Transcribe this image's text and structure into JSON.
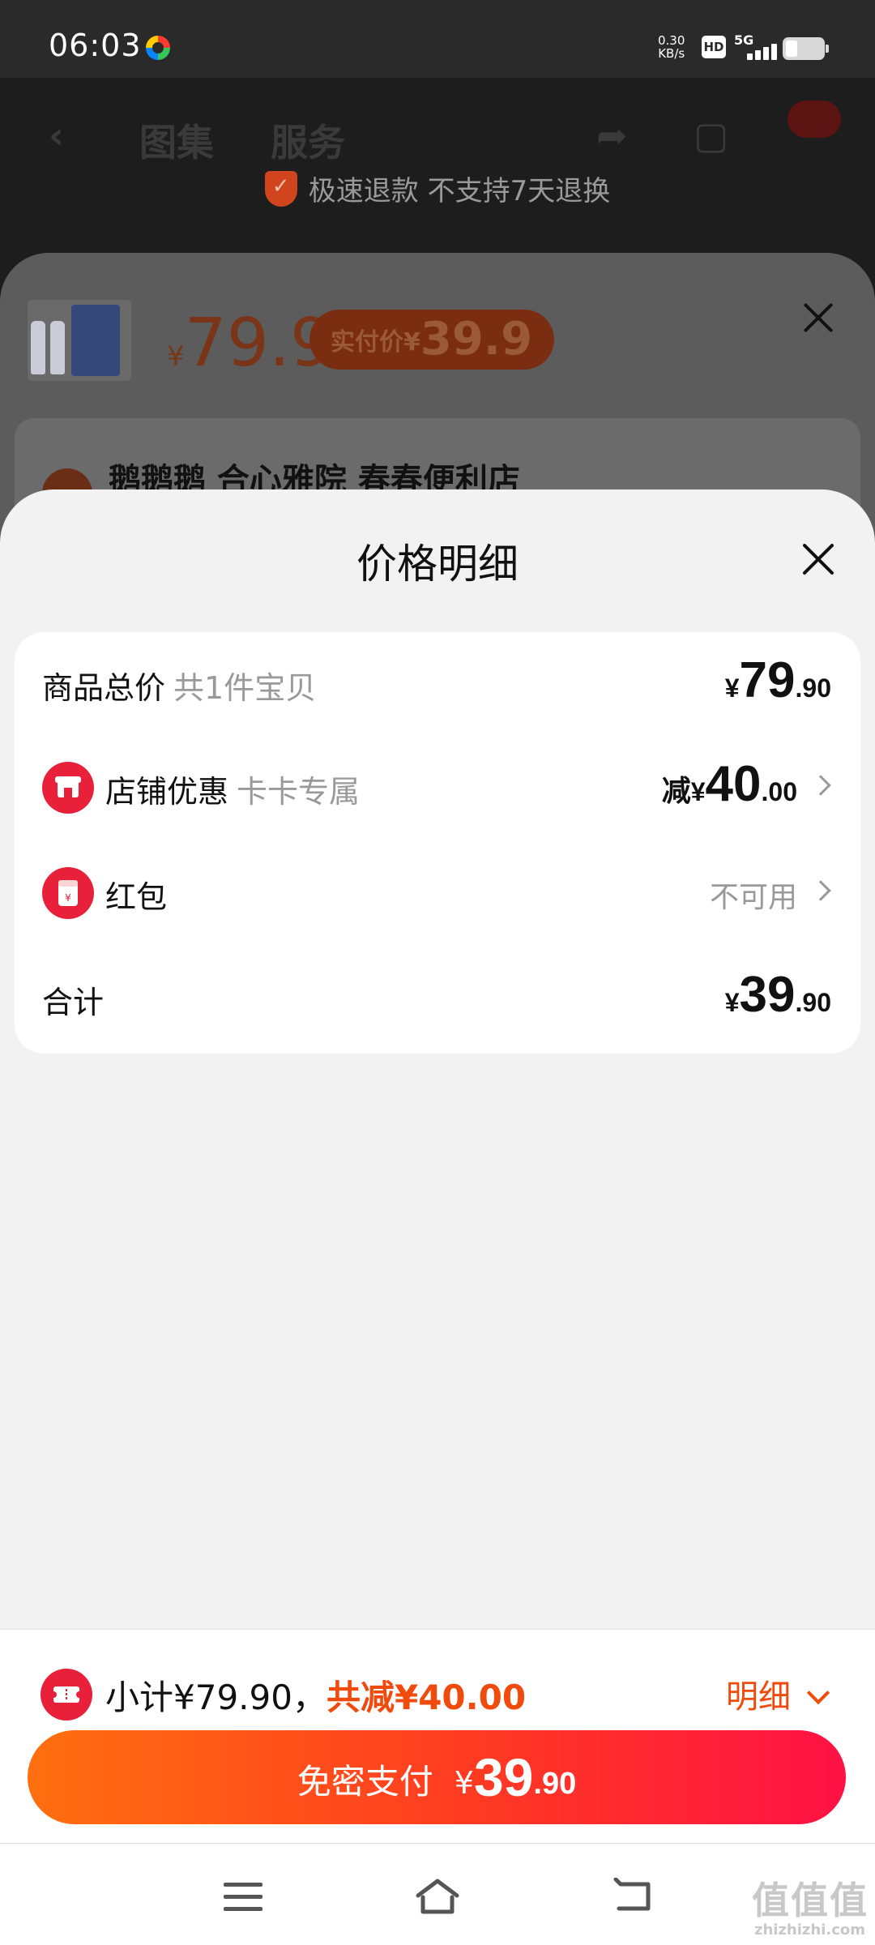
{
  "status_bar": {
    "time": "06:03",
    "net_speed": "0.30",
    "net_unit": "KB/s",
    "hd": "HD",
    "network": "5G"
  },
  "background_page": {
    "nav_tabs": [
      "图集",
      "服务"
    ],
    "guarantee": "极速退款 不支持7天退换",
    "product_price_currency": "¥",
    "product_price": "79.9",
    "actual_price_label": "实付价",
    "actual_price_currency": "¥",
    "actual_price": "39.9",
    "store_line": "鹅鹅鹅 合心雅院 春春便利店"
  },
  "price_detail": {
    "title": "价格明细",
    "rows": [
      {
        "label": "商品总价",
        "sub": "共1件宝贝",
        "currency": "¥",
        "int": "79",
        "dec": ".90"
      },
      {
        "label": "店铺优惠",
        "sub": "卡卡专属",
        "prefix": "减",
        "currency": "¥",
        "int": "40",
        "dec": ".00",
        "icon": "store-icon",
        "color": "#f04a0c"
      },
      {
        "label": "红包",
        "value": "不可用",
        "icon": "red-packet-icon"
      },
      {
        "label": "合计",
        "currency": "¥",
        "int": "39",
        "dec": ".90"
      }
    ]
  },
  "bottom_bar": {
    "subtotal_label": "小计¥79.90，",
    "saving_label": "共减¥40.00",
    "detail_label": "明细",
    "pay_label": "免密支付",
    "pay_currency": "¥",
    "pay_int": "39",
    "pay_dec": ".90",
    "accent": "#f04a0c"
  },
  "watermark": {
    "text": "值值值",
    "site": "zhizhizhi.com"
  }
}
